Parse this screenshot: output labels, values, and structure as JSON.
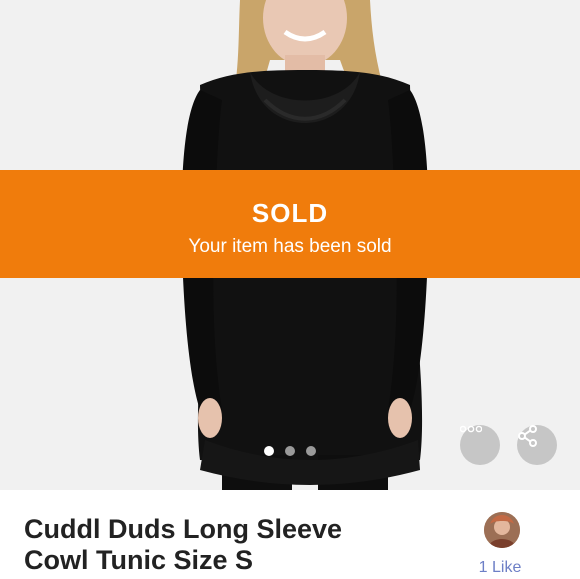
{
  "banner": {
    "title": "SOLD",
    "subtitle": "Your item has been sold"
  },
  "carousel": {
    "total_images": 3,
    "current_index": 1
  },
  "actions": {
    "more_icon": "more-horizontal-icon",
    "share_icon": "share-icon"
  },
  "listing": {
    "title_line1": "Cuddl Duds Long Sleeve",
    "title_line2": "Cowl Tunic Size S"
  },
  "likes": {
    "label": "1 Like"
  },
  "colors": {
    "banner": "#f07c0c",
    "like_text": "#6d7fc6"
  }
}
